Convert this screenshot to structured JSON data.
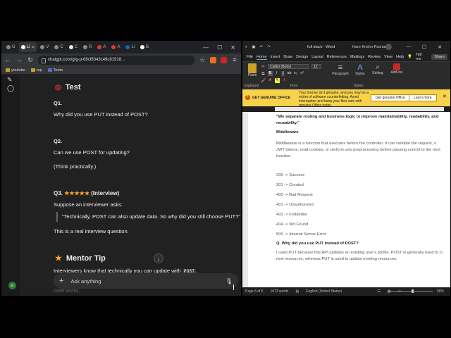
{
  "browser": {
    "tabs": [
      {
        "label": "G"
      },
      {
        "label": "Li",
        "active": true
      },
      {
        "label": "V"
      },
      {
        "label": "C"
      },
      {
        "label": "C"
      },
      {
        "label": "R"
      },
      {
        "label": "A"
      },
      {
        "label": "A"
      },
      {
        "label": "Li"
      },
      {
        "label": "B"
      }
    ],
    "url": "chatgpt.com/g/g-p-68cf8343c49c81918...",
    "bookmarks": [
      "youtube",
      "rep",
      "Tenta"
    ],
    "window_controls": {
      "minimize": "—",
      "maximize": "☐",
      "close": "✕"
    }
  },
  "chat": {
    "title": "Test",
    "q1_label": "Q1.",
    "q1_text": "Why did you use PUT instead of POST?",
    "q2_label": "Q2.",
    "q2_text": "Can we use POST for updating?",
    "q2_hint": "(Think practically.)",
    "q3_label": "Q3.",
    "q3_stars": "★★★★★",
    "q3_tag": "(Interview)",
    "q3_intro": "Suppose an interviewer asks:",
    "q3_quote": "\"Technically, POST can also update data. So why did you still choose PUT?\"",
    "q3_note": "This is a real interview question.",
    "tip_title": "Mentor Tip",
    "tip_text": "Interviewers know that technically you can update with",
    "tip_code": "POST",
    "faded_text": "code works.",
    "composer_placeholder": "Ask anything"
  },
  "word": {
    "doc_title": "full stack  -  Word",
    "user": "Hare Krishn Pachauri",
    "user_initials": "HK",
    "menu": [
      "File",
      "Home",
      "Insert",
      "Draw",
      "Design",
      "Layout",
      "References",
      "Mailings",
      "Review",
      "View",
      "Help"
    ],
    "tell_me": "Tell me",
    "share": "Share",
    "ribbon": {
      "paste": "Paste",
      "clipboard": "Clipboard",
      "font_name": "Calibri (Body)",
      "font_size": "12",
      "font": "Font",
      "paragraph": "Paragraph",
      "styles": "Styles",
      "editing": "Editing",
      "addins": "Add-ins"
    },
    "banner": {
      "title": "GET GENUINE OFFICE",
      "message": "Your license isn't genuine, and you may be a victim of software counterfeiting. Avoid interruption and keep your files safe with genuine Office today.",
      "primary": "Get genuine Office",
      "secondary": "Learn more"
    },
    "doc": {
      "quote_line1": "\"We separate routing and business logic to improve maintainability, readability, and",
      "quote_line2": "reusability.\"",
      "heading": "Middleware",
      "mw1": "Middleware is a function that executes before the controller. It can validate the request, v",
      "mw2": "JWT tokens, read cookies, or perform any preprocessing before passing control to the next",
      "mw3": "function.",
      "codes": [
        "200 -> Success",
        "201 -> Created",
        "400 -> Bad Request",
        "401 -> Unauthorized",
        "403 -> Forbidden",
        "404 -> Not Found",
        "500 -> Internal Server Error"
      ],
      "q_heading": "Q. Why did you use PUT instead of POST?",
      "ans1": "I used PUT because this API updates an existing user's profile. POST is generally used to cr",
      "ans2": "new resources, whereas PUT is used to update existing resources."
    },
    "status": {
      "page": "Page 6 of 6",
      "words": "1073 words",
      "lang": "English (United States)",
      "zoom": "96%"
    }
  }
}
